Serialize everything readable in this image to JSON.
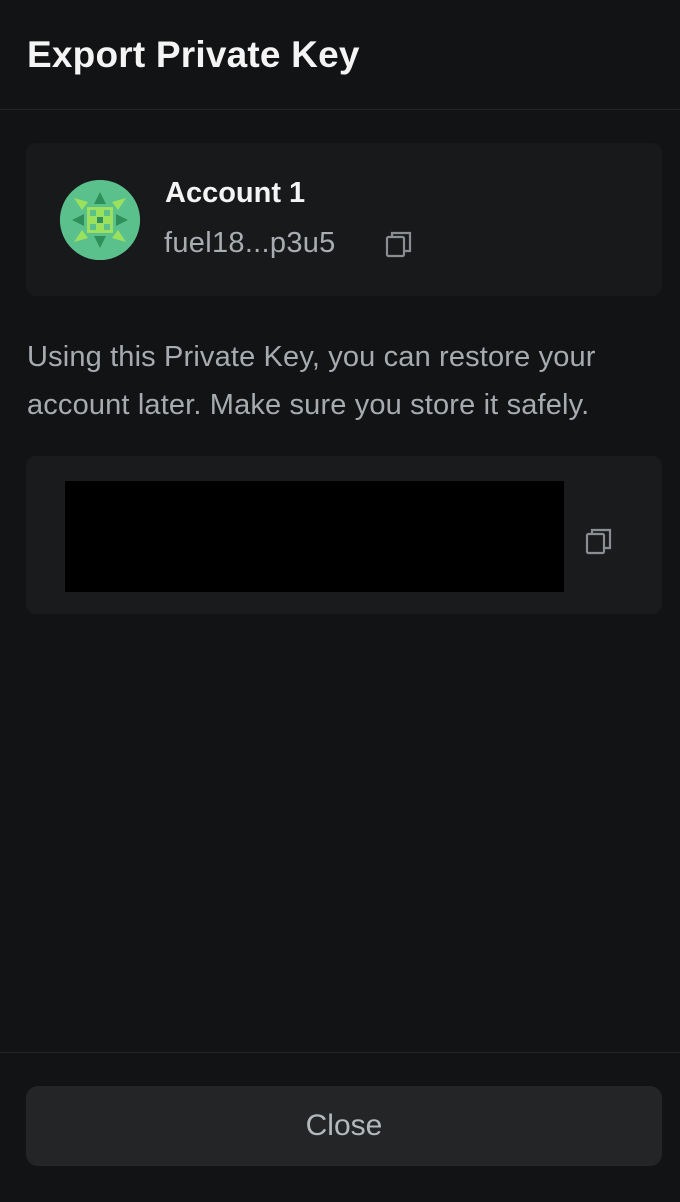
{
  "header": {
    "title": "Export Private Key"
  },
  "account": {
    "name": "Account 1",
    "address": "fuel18...p3u5",
    "avatar_icon": "identicon-avatar",
    "copy_icon": "copy-icon"
  },
  "description": "Using this Private Key, you can restore your account later. Make sure you store it safely.",
  "private_key": {
    "value": "",
    "copy_icon": "copy-icon"
  },
  "footer": {
    "close_label": "Close"
  },
  "colors": {
    "background": "#121314",
    "card": "#18191b",
    "button": "#232527",
    "avatar_green": "#5ac08c",
    "avatar_accent": "#9be15d"
  }
}
